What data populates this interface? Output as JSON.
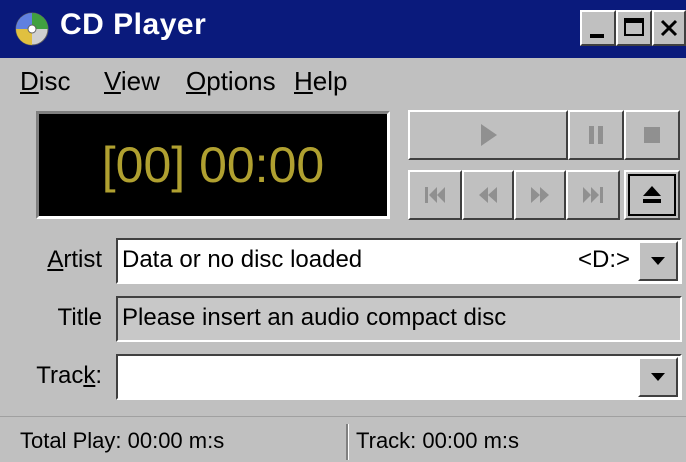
{
  "window": {
    "title": "CD Player",
    "icon": "cd-disc-icon"
  },
  "caption_buttons": {
    "minimize": "minimize-icon",
    "maximize": "maximize-icon",
    "close": "close-icon"
  },
  "menu": {
    "disc": {
      "accel": "D",
      "rest": "isc"
    },
    "view": {
      "accel": "V",
      "rest": "iew"
    },
    "options": {
      "accel": "O",
      "rest": "ptions"
    },
    "help": {
      "accel": "H",
      "rest": "elp"
    }
  },
  "display": {
    "readout": "[00] 00:00",
    "color": "#b0a030"
  },
  "transport": {
    "play": "play-icon",
    "pause": "pause-icon",
    "stop": "stop-icon",
    "previous": "skip-back-icon",
    "rewind": "rewind-icon",
    "fast_forward": "fast-forward-icon",
    "next": "skip-forward-icon",
    "eject": "eject-icon"
  },
  "fields": {
    "artist": {
      "label": "Artist",
      "accel": "A",
      "label_rest": "rtist",
      "value": "Data or no disc loaded",
      "drive": "<D:>"
    },
    "title": {
      "label": "Title",
      "value": "Please insert an audio compact disc"
    },
    "track": {
      "label_prefix": "Trac",
      "accel": "k",
      "label_suffix": ":",
      "value": ""
    }
  },
  "status": {
    "total_play": "Total Play: 00:00 m:s",
    "track": "Track: 00:00 m:s"
  }
}
